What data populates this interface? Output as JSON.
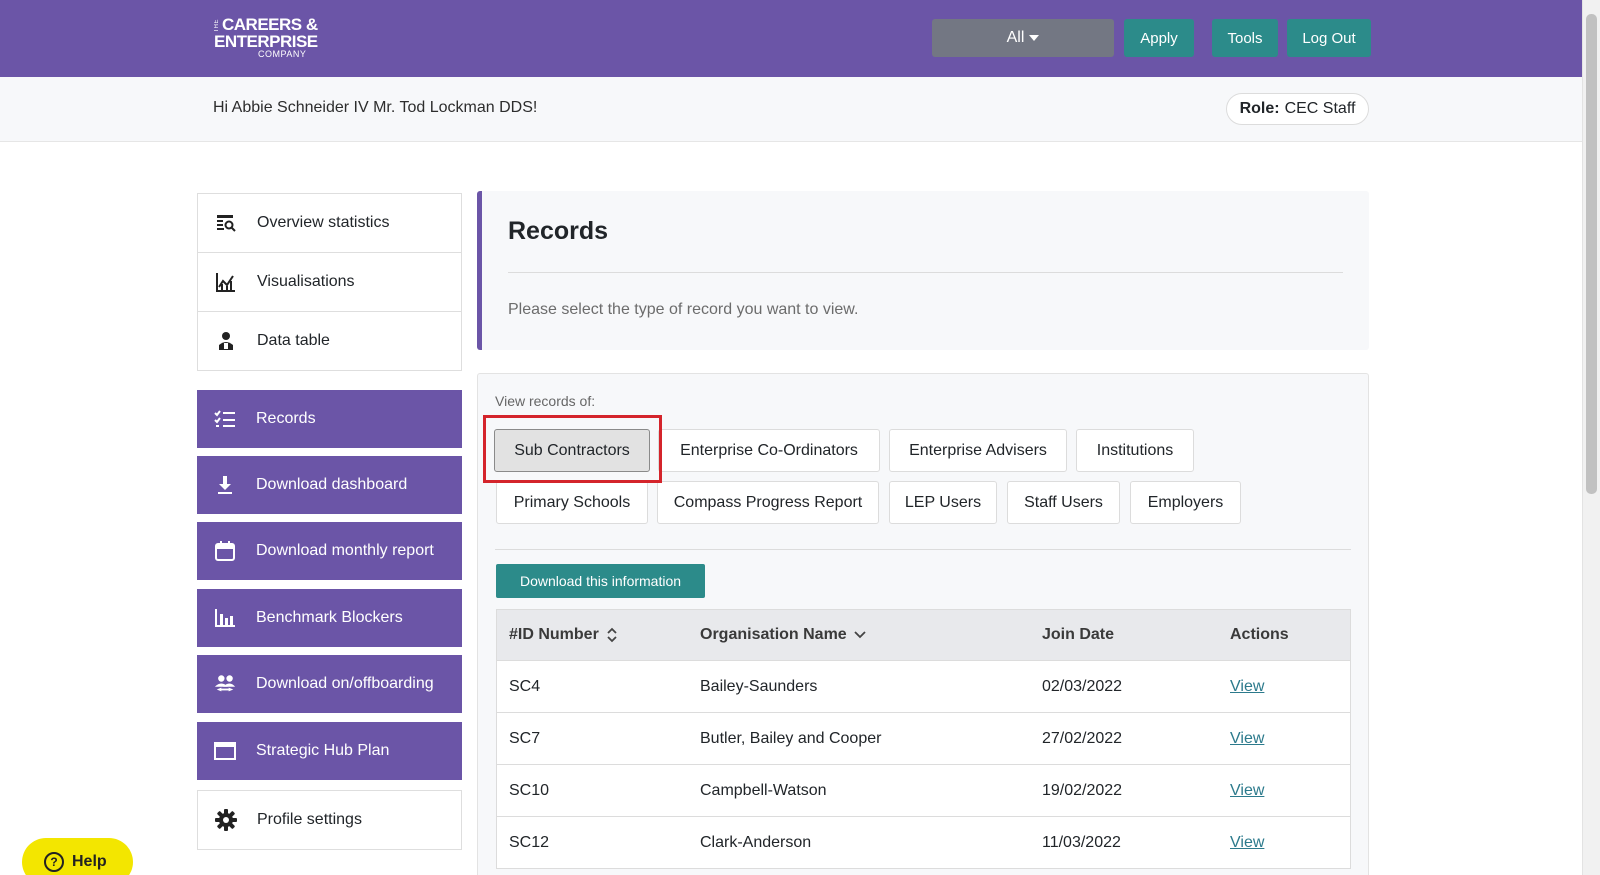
{
  "header": {
    "logo": {
      "the": "THE",
      "line1": "CAREERS &",
      "line2": "ENTERPRISE",
      "line3": "COMPANY"
    },
    "filter_label": "All",
    "apply_label": "Apply",
    "tools_label": "Tools",
    "logout_label": "Log Out"
  },
  "greeting": "Hi Abbie Schneider IV Mr. Tod Lockman DDS!",
  "role": {
    "label": "Role:",
    "value": "CEC Staff"
  },
  "sidebar": {
    "top_items": [
      {
        "label": "Overview statistics",
        "icon": "overview-stats-icon"
      },
      {
        "label": "Visualisations",
        "icon": "chart-icon"
      },
      {
        "label": "Data table",
        "icon": "person-table-icon"
      }
    ],
    "action_items": [
      {
        "label": "Records",
        "icon": "list-icon"
      },
      {
        "label": "Download dashboard",
        "icon": "download-icon"
      },
      {
        "label": "Download monthly report",
        "icon": "calendar-icon"
      },
      {
        "label": "Benchmark Blockers",
        "icon": "bar-chart-icon"
      },
      {
        "label": "Download on/offboarding",
        "icon": "people-icon"
      },
      {
        "label": "Strategic Hub Plan",
        "icon": "window-icon"
      }
    ],
    "bottom_item": {
      "label": "Profile settings",
      "icon": "gear-icon"
    }
  },
  "records": {
    "title": "Records",
    "subtitle": "Please select the type of record you want to view."
  },
  "filters": {
    "label": "View records of:",
    "chips": [
      "Sub Contractors",
      "Enterprise Co-Ordinators",
      "Enterprise Advisers",
      "Institutions",
      "Primary Schools",
      "Compass Progress Report",
      "LEP Users",
      "Staff Users",
      "Employers"
    ],
    "active": "Sub Contractors",
    "download_label": "Download this information"
  },
  "table": {
    "columns": [
      "#ID Number",
      "Organisation Name",
      "Join Date",
      "Actions"
    ],
    "rows": [
      {
        "id": "SC4",
        "name": "Bailey-Saunders",
        "date": "02/03/2022",
        "action": "View"
      },
      {
        "id": "SC7",
        "name": "Butler, Bailey and Cooper",
        "date": "27/02/2022",
        "action": "View"
      },
      {
        "id": "SC10",
        "name": "Campbell-Watson",
        "date": "19/02/2022",
        "action": "View"
      },
      {
        "id": "SC12",
        "name": "Clark-Anderson",
        "date": "11/03/2022",
        "action": "View"
      }
    ]
  },
  "help_label": "Help",
  "colors": {
    "primary": "#6b55a7",
    "teal": "#2c8b8a",
    "help_yellow": "#f3e600",
    "highlight_red": "#d4242b"
  }
}
